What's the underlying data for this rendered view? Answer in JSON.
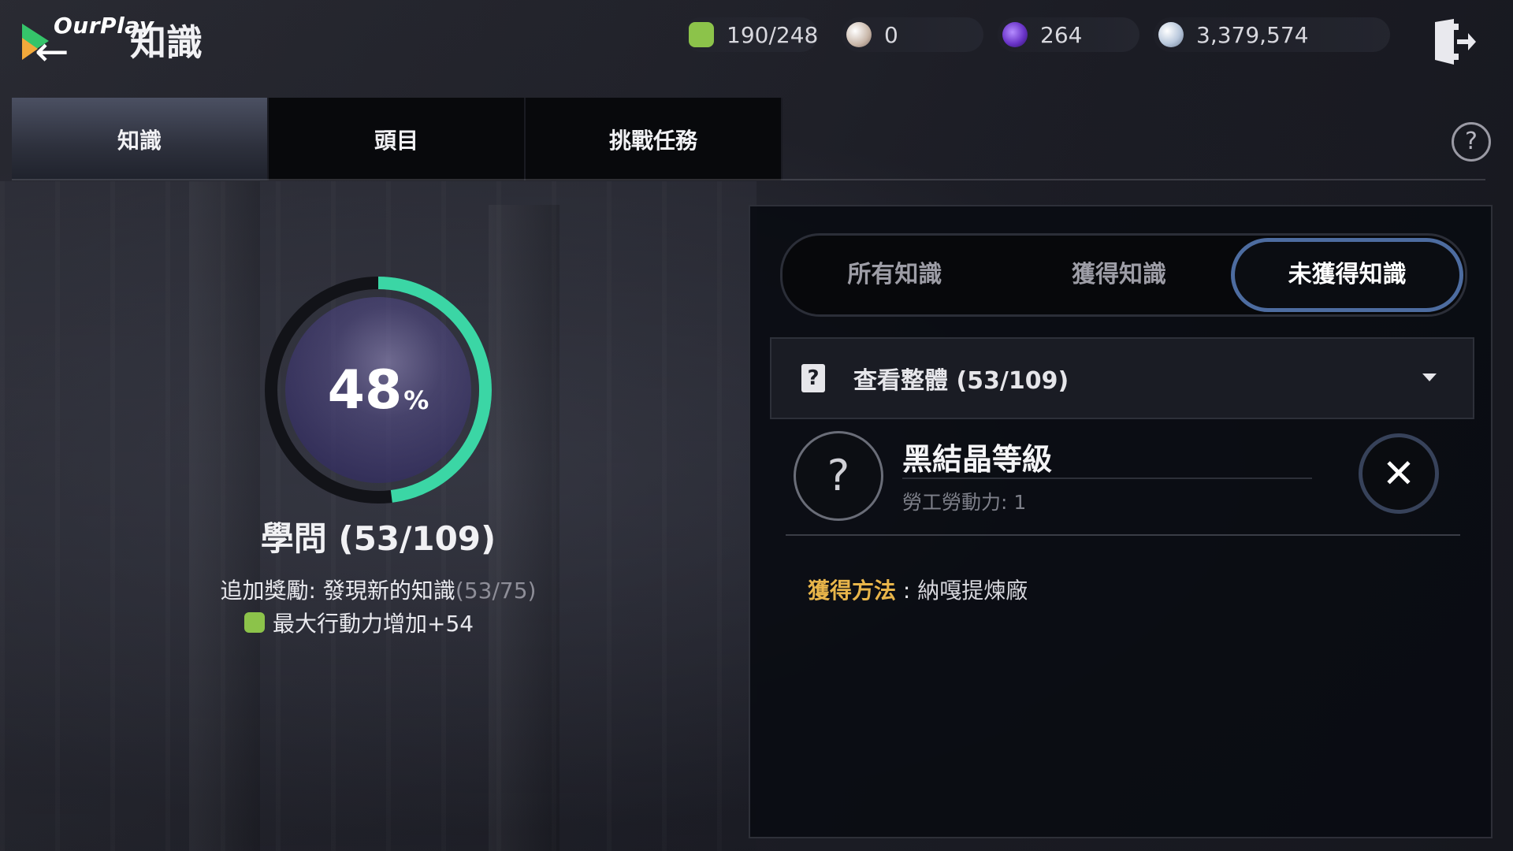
{
  "app": {
    "brand": "OurPlay",
    "title": "知識"
  },
  "resources": [
    {
      "icon": "energy-icon",
      "value": "190/248",
      "color": "#8cc34a"
    },
    {
      "icon": "pearl-icon",
      "value": "0",
      "color": "#e0d2c8"
    },
    {
      "icon": "crystal-icon",
      "value": "264",
      "color": "#7b4ad6"
    },
    {
      "icon": "silver-icon",
      "value": "3,379,574",
      "color": "#c9d6e8"
    }
  ],
  "tabs": [
    {
      "label": "知識",
      "active": true
    },
    {
      "label": "頭目",
      "active": false
    },
    {
      "label": "挑戰任務",
      "active": false
    }
  ],
  "progress": {
    "percent": "48",
    "percent_sign": "%",
    "fraction": 0.48,
    "label": "學問 (53/109)",
    "bonus_text": "追加獎勵: 發現新的知識",
    "bonus_count": "(53/75)",
    "reward_text": "最大行動力增加+54",
    "ring_color": "#3bd6a5"
  },
  "filters": [
    {
      "label": "所有知識",
      "active": false
    },
    {
      "label": "獲得知識",
      "active": false
    },
    {
      "label": "未獲得知識",
      "active": true
    }
  ],
  "dropdown": {
    "icon": "?",
    "label": "查看整體 (53/109)"
  },
  "item": {
    "icon": "?",
    "title": "黑結晶等級",
    "subtitle": "勞工勞動力: 1"
  },
  "acquire": {
    "label": "獲得方法",
    "separator": " : ",
    "value": "納嘎提煉廠"
  }
}
